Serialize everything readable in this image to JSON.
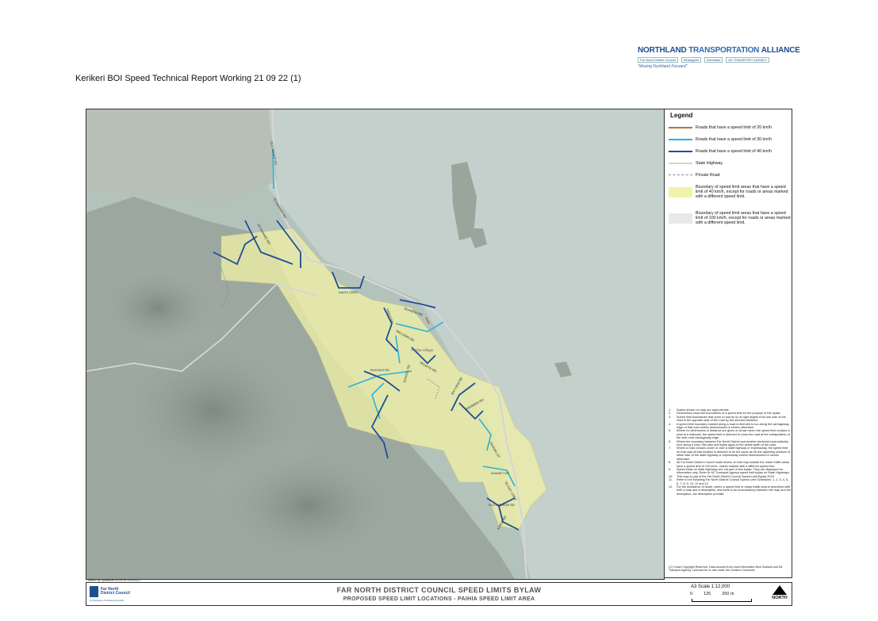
{
  "document": {
    "title": "Kerikeri BOI Speed Technical Report Working 21 09 22 (1)"
  },
  "nta_logo": {
    "name_a": "NORTHLAND",
    "name_b": "TRANSPORTATION",
    "name_c": "ALLIANCE",
    "partner1": "Far North District Council",
    "partner2": "Whangarei",
    "partner3": "Northland",
    "partner4": "NZ TRANSPORT AGENCY",
    "tagline": "\"Moving Northland Forward\""
  },
  "legend": {
    "title": "Legend",
    "items": [
      {
        "label": "Roads that have a speed limit of 20 km/h",
        "color": "#b87333"
      },
      {
        "label": "Roads that have a speed limit of 30 km/h",
        "color": "#2ab4d8"
      },
      {
        "label": "Roads that have a speed limit of 40 km/h",
        "color": "#1f4e96"
      },
      {
        "label": "State Highway",
        "color": "#d4d4d4"
      },
      {
        "label": "Private Road",
        "color": "#7a8aa8"
      },
      {
        "label": "Boundary of speed limit areas that have a speed limit of 40 km/h, except for roads or areas marked with a different speed limit.",
        "color": "#f2f2a8"
      },
      {
        "label": "Boundary of speed limit areas that have a speed limit of 100 km/h, except for roads or areas marked with a different speed limit.",
        "color": "#e8e8e8"
      }
    ],
    "notes": [
      {
        "n": "1.",
        "text": "Scales shown on map are approximate."
      },
      {
        "n": "2.",
        "text": "Dimensions show the boundaries of a speed limit for the purpose of the bylaw."
      },
      {
        "n": "3.",
        "text": "Speed limit boundaries that cross a road do so at right angles from one side of the road to the opposite side of the road by the shortest distance."
      },
      {
        "n": "4.",
        "text": "A speed limit boundary marked along a road is deemed to run along the carriageway edge of that road unless dimensioned or shown otherwise."
      },
      {
        "n": "5.",
        "text": "Where no dimensions or distance are given or shown when the speed limit crosses a road at a sideroad, the speed limit is deemed to cross the road at the extrapolation of the side road carriageway edge."
      },
      {
        "n": "6.",
        "text": "Where the boundary between Far North District and another territorial local authority runs along a road, this plan and bylaw apply to the whole width of the road."
      },
      {
        "n": "7.",
        "text": "Where a road crosses under or over a state highway or expressway, the speed limit on that road at that location is deemed to be the same as for the adjoining sections of either side of the state highway or expressway unless dimensioned or shown otherwise."
      },
      {
        "n": "8.",
        "text": "All Far North District Council roads shown on this map outside the urban traffic areas have a speed limit of 100 km/h, unless marked with a different speed limit."
      },
      {
        "n": "9.",
        "text": "Speed limits on state highways are not part of this bylaw. They are displayed for information only. Refer to NZ Transport Agency speed limit bylaw on State Highways."
      },
      {
        "n": "10.",
        "text": "This map is part of the Far North District Council Speed Limit Bylaw 2019."
      },
      {
        "n": "11.",
        "text": "Refer to the following Far North District Council Speed Limit Schedules: 1, 2, 3, 4, 5, 6, 7, 8, 9, 10, 11 and 12"
      },
      {
        "n": "12.",
        "text": "For the avoidance of doubt, where a speed limit or urban traffic area is described with both a map and a description, and there is an inconsistency between the map and the description, the description prevails."
      }
    ],
    "copyright": "(C) Crown Copyright Reserved. Data sourced from Land Information New Zealand and NZ Transport Agency. Licensed for re-use under the Creative Commons."
  },
  "map": {
    "created_by": "Created by Spatialize.co.nz on 6/09/2022",
    "road_labels": [
      "OLD WHARF RD",
      "TE HARAKE RD",
      "DAVIS CRES",
      "SEAVIEW RD",
      "KINGS RD",
      "WILLIAMS RD",
      "RHODES RD",
      "SCHOOL RD",
      "SELWYN RD",
      "BAYVIEW RD",
      "MARSDEN RD",
      "TAHIWAI ST",
      "SUNSET DR",
      "TE PATI CRES",
      "OLD MISSION RD",
      "KINGS RD"
    ],
    "place_label": "Paihia Village"
  },
  "footer": {
    "council_name_1": "Far North",
    "council_name_2": "District Council",
    "council_tag": "Te Kaunihera o Tai Tokerau ki te Raki",
    "title": "FAR NORTH DISTRICT COUNCIL SPEED LIMITS BYLAW",
    "subtitle": "PROPOSED SPEED LIMIT LOCATIONS - PAIHIA SPEED LIMIT AREA",
    "scale_label": "A3 Scale 1:12,000",
    "scale_ticks": [
      "0",
      "125",
      "250 m"
    ],
    "north_label": "NORTH"
  }
}
